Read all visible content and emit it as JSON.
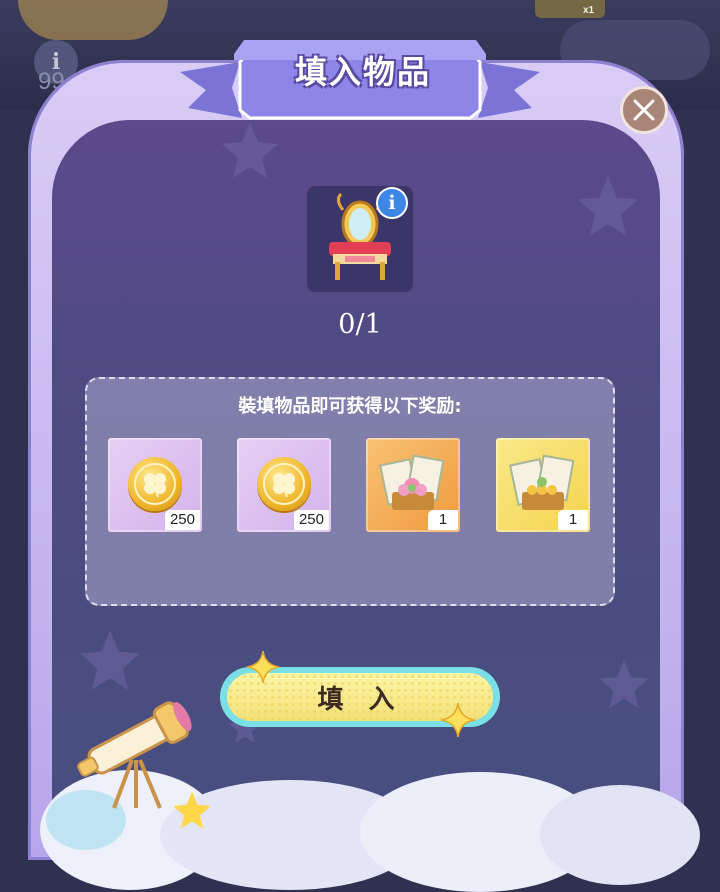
{
  "background": {
    "level_icon": "i",
    "level_number": "99",
    "chip_count": "x1"
  },
  "dialog": {
    "title": "填入物品",
    "close_icon": "close-icon",
    "item": {
      "name_icon": "vanity-mirror-icon",
      "info_icon": "i",
      "progress": "0/1"
    },
    "rewards": {
      "heading": "裝填物品即可获得以下奖励:",
      "items": [
        {
          "icon": "clover-coin-icon",
          "quantity": "250",
          "color": "#dcc0f0"
        },
        {
          "icon": "clover-coin-icon",
          "quantity": "250",
          "color": "#dcc0f0"
        },
        {
          "icon": "photo-card-pack-icon",
          "quantity": "1",
          "color": "#f5ad55"
        },
        {
          "icon": "photo-card-pack-icon",
          "quantity": "1",
          "color": "#f7df6a"
        }
      ]
    },
    "fill_button": "填 入"
  },
  "colors": {
    "panel_border": "#c8b9f2",
    "panel_bg": "#4e4b82",
    "ribbon": "#8f86e6",
    "button": "#f6e683",
    "button_rim": "#7be0e6"
  }
}
